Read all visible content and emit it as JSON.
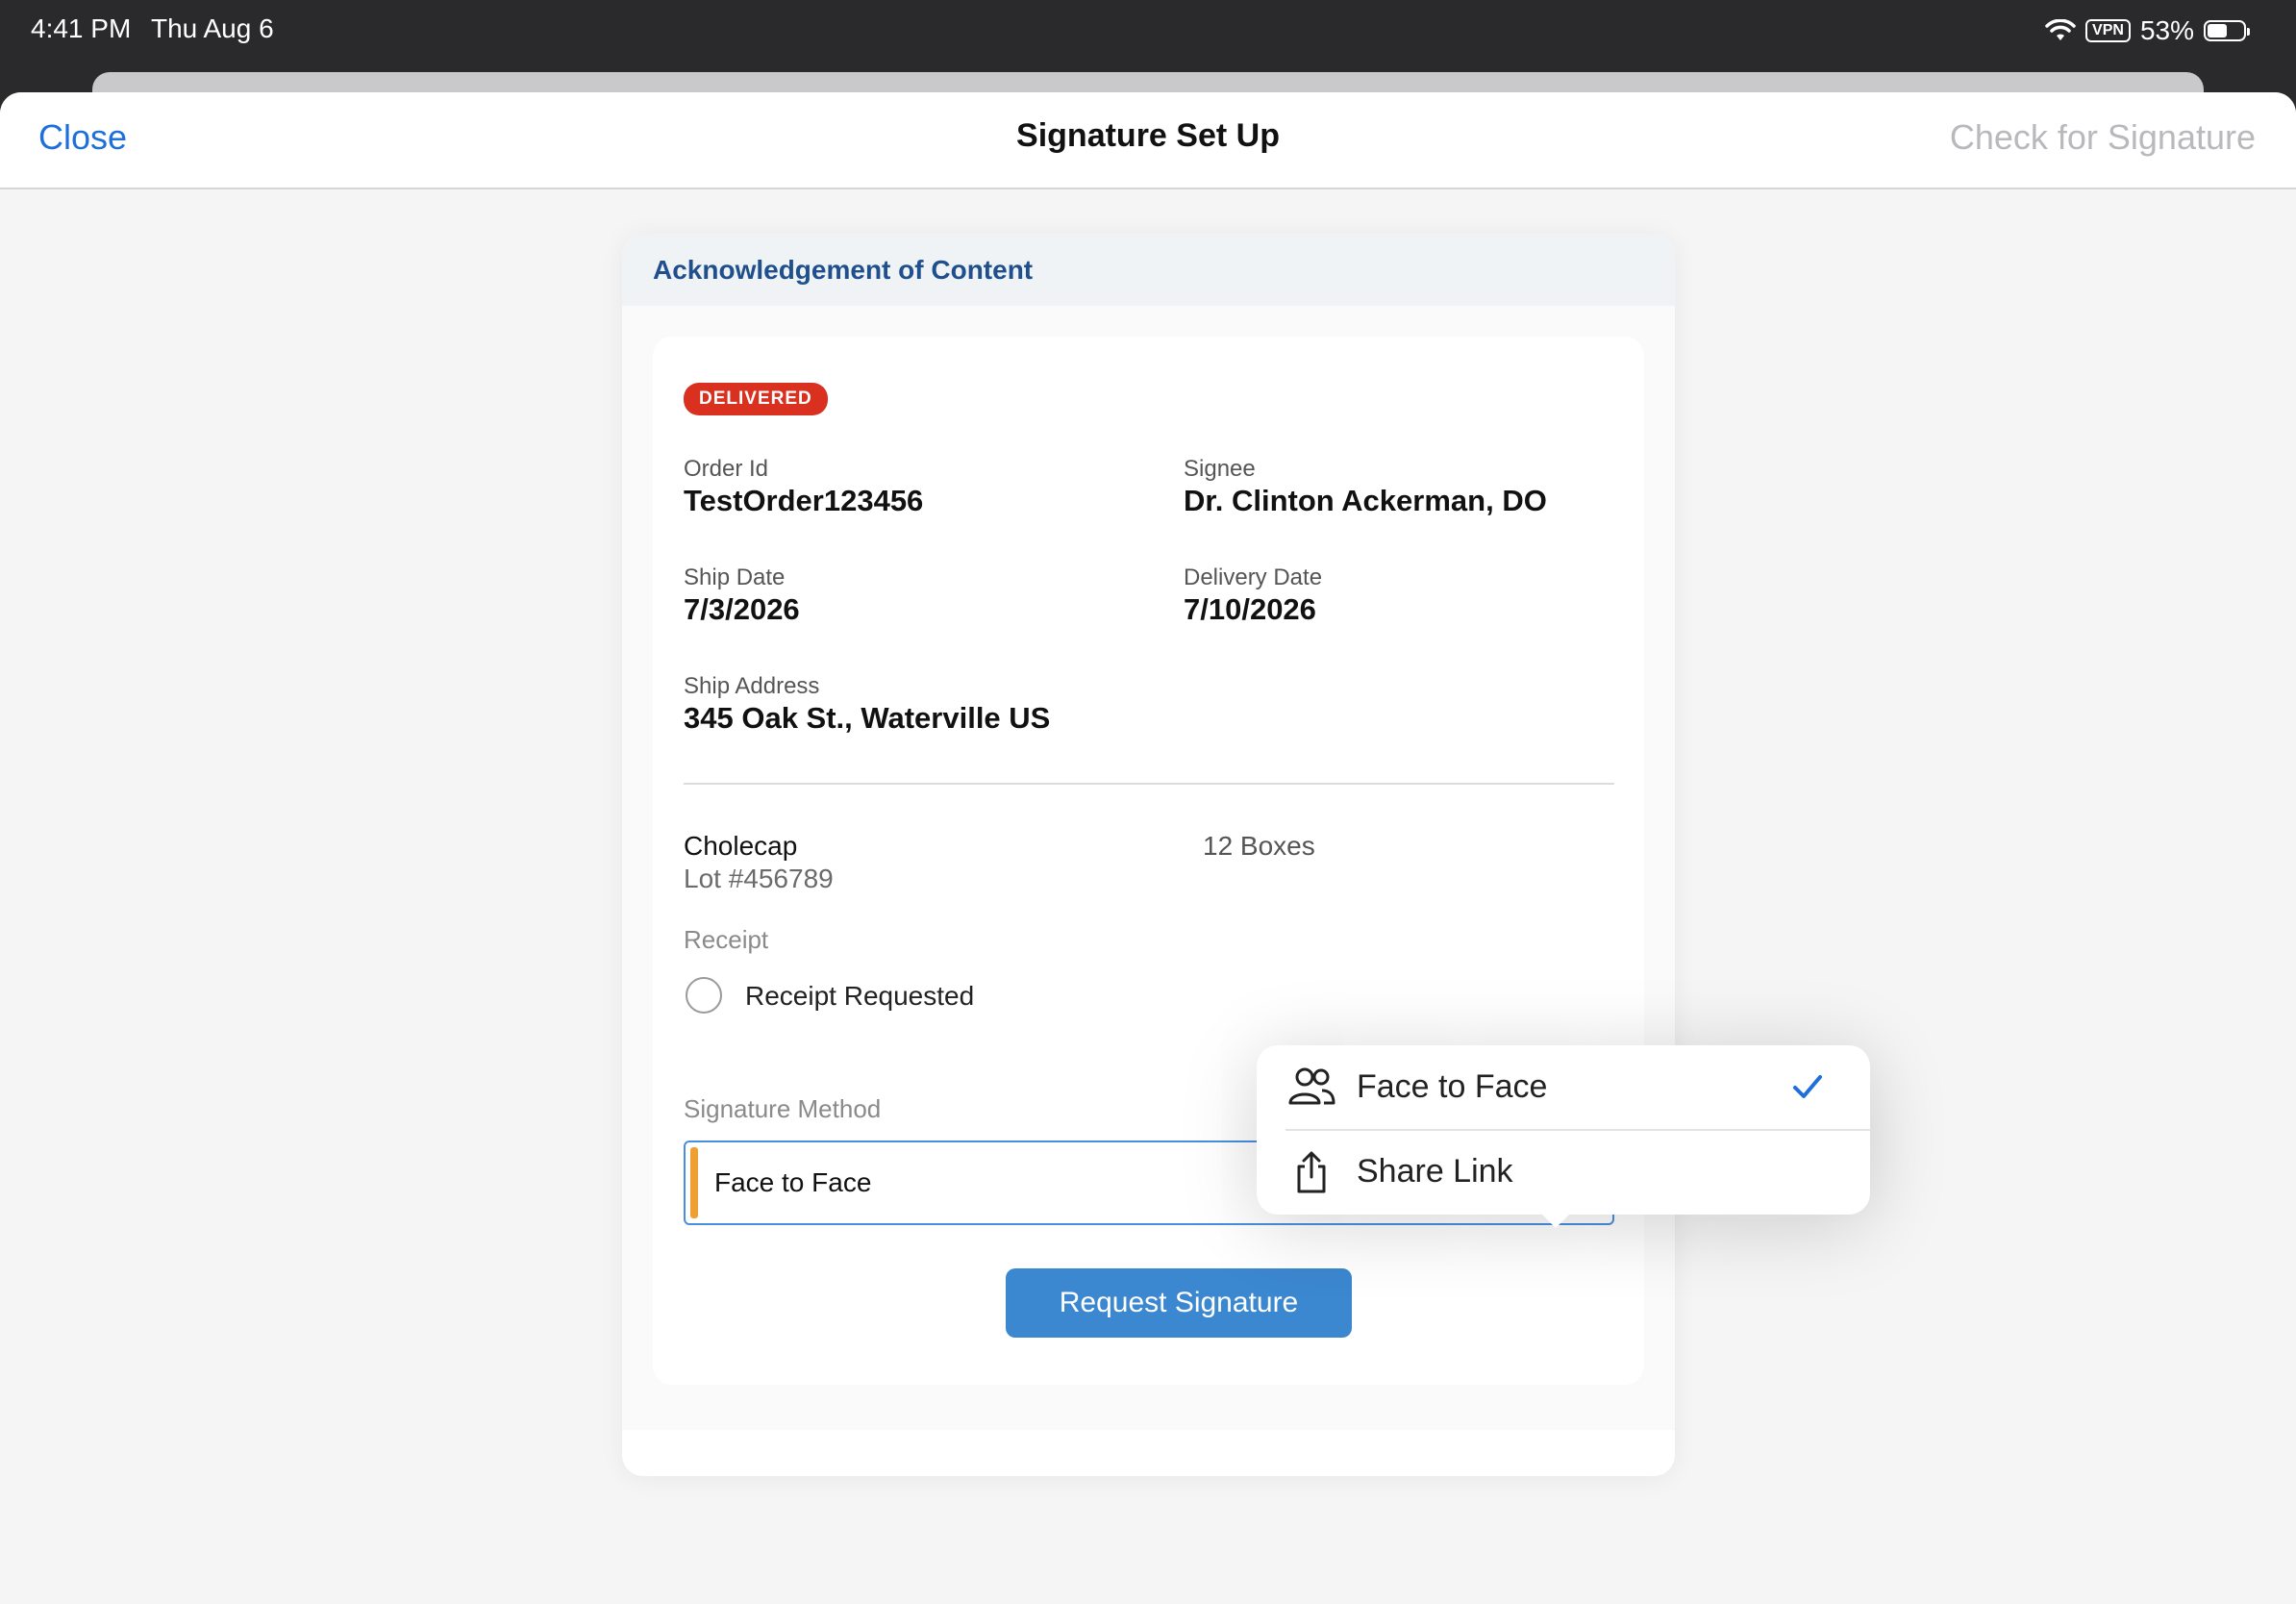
{
  "status_bar": {
    "time": "4:41 PM",
    "date": "Thu Aug 6",
    "vpn": "VPN",
    "battery": "53%",
    "icons": [
      "wifi-icon",
      "vpn-badge",
      "battery-icon"
    ]
  },
  "nav": {
    "close_label": "Close",
    "title": "Signature Set Up",
    "check_label": "Check for Signature"
  },
  "panel": {
    "title": "Acknowledgement of Content"
  },
  "order": {
    "status_badge": "DELIVERED",
    "order_id_label": "Order Id",
    "order_id": "TestOrder123456",
    "signee_label": "Signee",
    "signee": "Dr. Clinton Ackerman, DO",
    "ship_date_label": "Ship Date",
    "ship_date": "7/3/2026",
    "delivery_date_label": "Delivery Date",
    "delivery_date": "7/10/2026",
    "ship_address_label": "Ship Address",
    "ship_address": "345 Oak St., Waterville US"
  },
  "product": {
    "name": "Cholecap",
    "lot": "Lot #456789",
    "quantity": "12 Boxes"
  },
  "receipt": {
    "label": "Receipt",
    "option": "Receipt Requested",
    "checked": false
  },
  "signature_method": {
    "label": "Signature Method",
    "value": "Face to Face",
    "options": [
      {
        "label": "Face to Face",
        "icon": "people-icon",
        "selected": true
      },
      {
        "label": "Share Link",
        "icon": "share-icon",
        "selected": false
      }
    ]
  },
  "actions": {
    "request_label": "Request Signature"
  },
  "colors": {
    "accent_blue": "#1e6fd9",
    "badge_red": "#d9301f",
    "button_blue": "#3b87d0",
    "select_accent": "#f0a033",
    "header_title": "#1f4f8c"
  }
}
